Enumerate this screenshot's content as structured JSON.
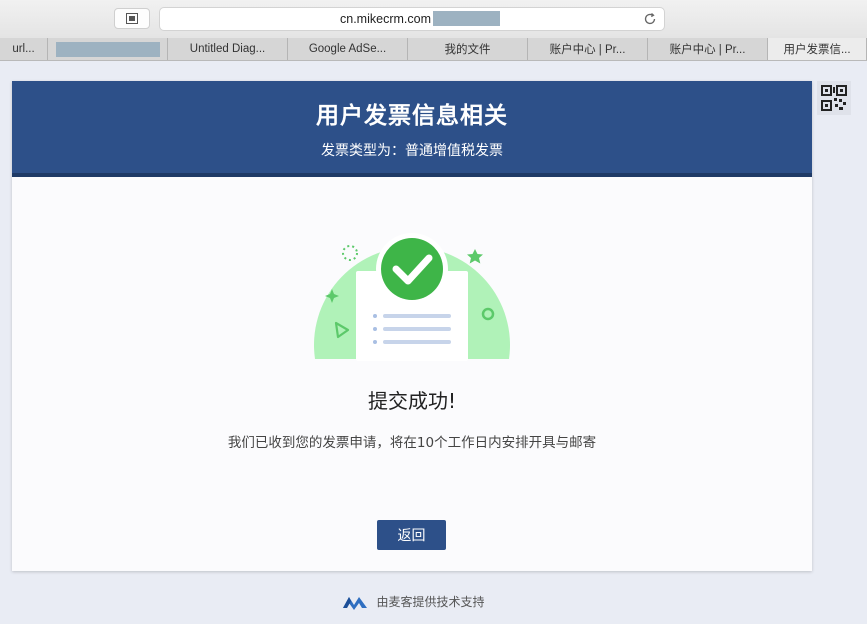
{
  "browser": {
    "url": "cn.mikecrm.com",
    "tabs": [
      {
        "label": "url..."
      },
      {
        "label": ""
      },
      {
        "label": "Untitled Diag..."
      },
      {
        "label": "Google AdSe..."
      },
      {
        "label": "我的文件"
      },
      {
        "label": "账户中心 | Pr..."
      },
      {
        "label": "账户中心 | Pr..."
      },
      {
        "label": "用户发票信..."
      }
    ]
  },
  "form": {
    "title": "用户发票信息相关",
    "subtitle": "发票类型为：普通增值税发票",
    "success_title": "提交成功!",
    "success_message": "我们已收到您的发票申请，将在10个工作日内安排开具与邮寄",
    "back_label": "返回"
  },
  "footer": {
    "text": "由麦客提供技术支持"
  },
  "colors": {
    "header": "#2d5089",
    "success_green": "#3eb548",
    "circle_bg": "#b0f2b8"
  }
}
